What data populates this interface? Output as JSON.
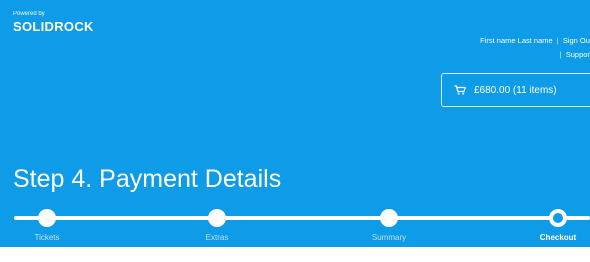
{
  "brand": {
    "powered_by": "Powered by",
    "logo": "SOLIDROCK"
  },
  "user": {
    "name": "First name Last name",
    "sign_out": "Sign Out",
    "support": "Support",
    "separator": "|"
  },
  "cart": {
    "icon": "cart-icon",
    "label": "£680.00 (11 items)"
  },
  "page": {
    "title": "Step 4. Payment Details"
  },
  "steps": [
    {
      "label": "Tickets",
      "state": "completed"
    },
    {
      "label": "Extras",
      "state": "completed"
    },
    {
      "label": "Summary",
      "state": "completed"
    },
    {
      "label": "Checkout",
      "state": "current"
    }
  ],
  "colors": {
    "header_bg": "#0e9be8",
    "text": "#ffffff",
    "page_bg": "#ffffff"
  }
}
